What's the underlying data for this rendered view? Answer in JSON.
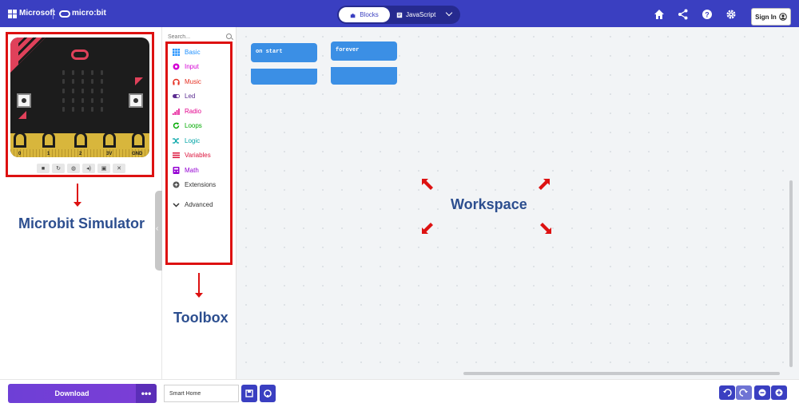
{
  "header": {
    "brand_microsoft": "Microsoft",
    "brand_microbit": "micro:bit",
    "mode_blocks": "Blocks",
    "mode_javascript": "JavaScript",
    "signin_label": "Sign In",
    "icons": [
      "home-icon",
      "share-icon",
      "help-icon",
      "gear-icon",
      "user-icon"
    ],
    "colors": {
      "bar": "#3a3fc1"
    }
  },
  "simulator": {
    "pins": [
      "0",
      "1",
      "2",
      "3V",
      "GND"
    ],
    "controls": [
      "■",
      "↻",
      "◍",
      "◂)",
      "▣",
      "✕"
    ],
    "annotation": "Microbit Simulator"
  },
  "toolbox": {
    "search_placeholder": "Search...",
    "categories": [
      {
        "label": "Basic",
        "color": "#1e90ff",
        "icon": "grid-icon"
      },
      {
        "label": "Input",
        "color": "#d400d4",
        "icon": "input-icon"
      },
      {
        "label": "Music",
        "color": "#e63022",
        "icon": "headphones-icon"
      },
      {
        "label": "Led",
        "color": "#5c2d91",
        "icon": "toggle-icon"
      },
      {
        "label": "Radio",
        "color": "#e3008c",
        "icon": "signal-icon"
      },
      {
        "label": "Loops",
        "color": "#00aa00",
        "icon": "refresh-icon"
      },
      {
        "label": "Logic",
        "color": "#00a4a6",
        "icon": "shuffle-icon"
      },
      {
        "label": "Variables",
        "color": "#dc143c",
        "icon": "list-icon"
      },
      {
        "label": "Math",
        "color": "#9400d3",
        "icon": "calculator-icon"
      },
      {
        "label": "Extensions",
        "color": "#555555",
        "icon": "plus-circle-icon"
      },
      {
        "label": "Advanced",
        "color": "#333333",
        "icon": "chevron-down-icon"
      }
    ],
    "annotation": "Toolbox"
  },
  "workspace": {
    "blocks": [
      {
        "label": "on start"
      },
      {
        "label": "forever"
      }
    ],
    "annotation": "Workspace",
    "colors": {
      "block": "#3b8fe5",
      "arrow": "#dd1111"
    }
  },
  "bottombar": {
    "download_label": "Download",
    "more_label": "•••",
    "project_name": "Smart Home"
  }
}
